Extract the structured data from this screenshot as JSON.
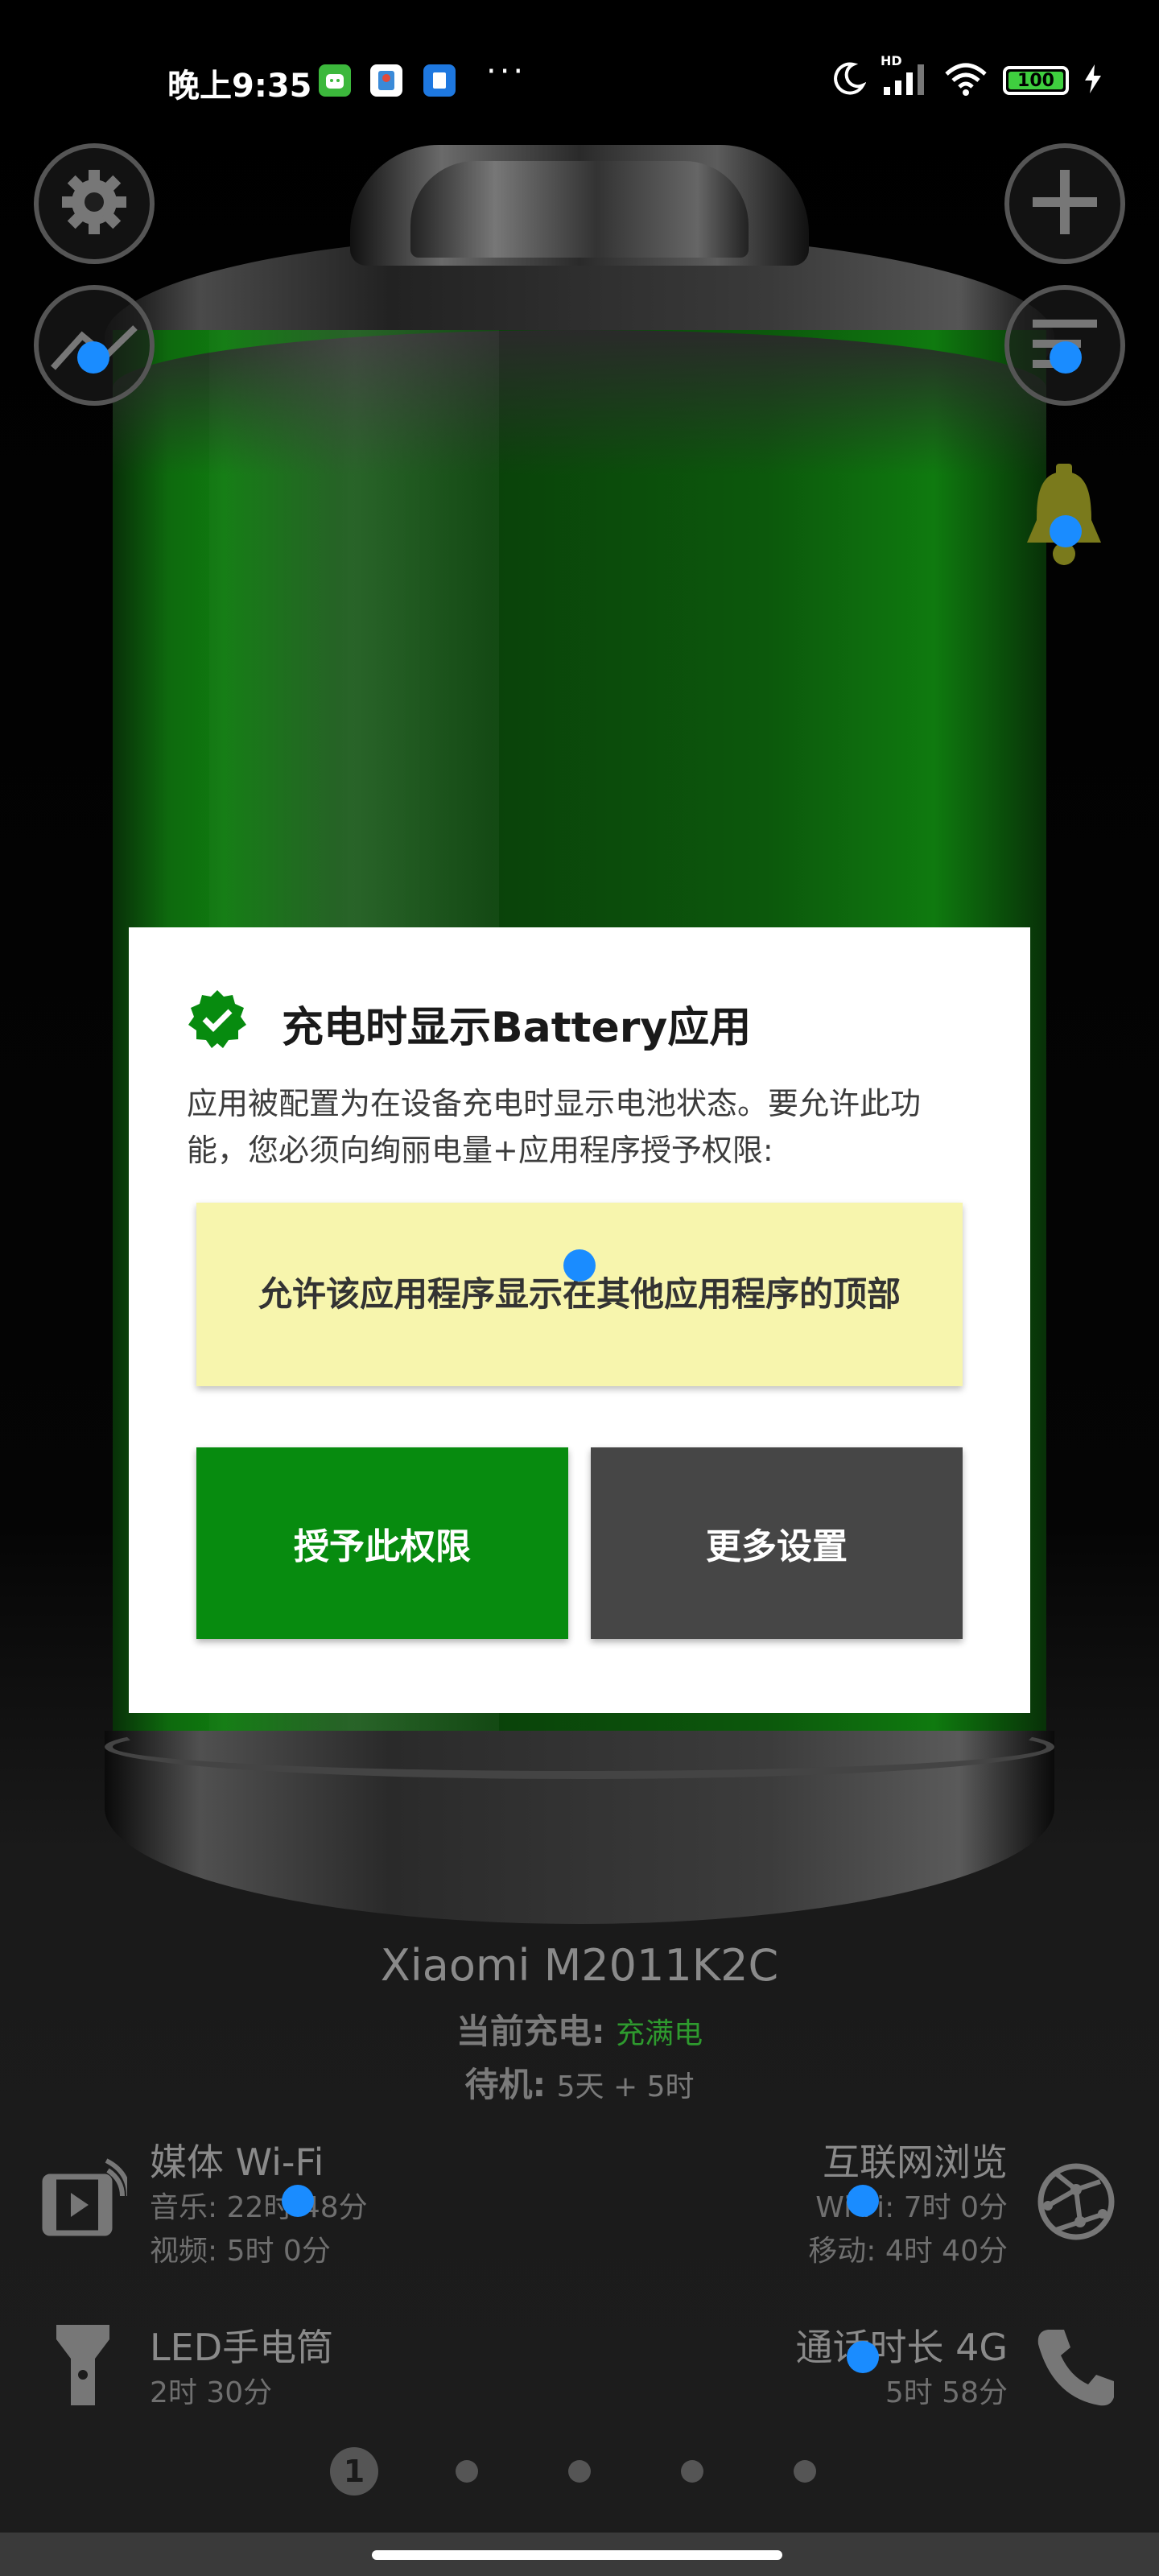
{
  "status_bar": {
    "time": "晚上9:35",
    "signal_label": "HD",
    "battery_level": "100",
    "icons": [
      "android-app-icon",
      "app-icon-2",
      "app-icon-3",
      "more-dots-icon",
      "moon-icon",
      "signal-icon",
      "wifi-icon",
      "battery-icon",
      "charging-bolt-icon"
    ],
    "more_dots": "···"
  },
  "top_controls": {
    "left": [
      "gear-icon",
      "chart-icon"
    ],
    "right": [
      "plus-icon",
      "filter-icon",
      "bell-icon"
    ]
  },
  "dialog": {
    "title": "充电时显示Battery应用",
    "body": "应用被配置为在设备充电时显示电池状态。要允许此功能，您必须向绚丽电量+应用程序授予权限:",
    "permission_text": "允许该应用程序显示在其他应用程序的顶部",
    "grant_button": "授予此权限",
    "more_settings_button": "更多设置",
    "accent_color": "#078b0f"
  },
  "device": {
    "name": "Xiaomi M2011K2C",
    "charging_label": "当前充电:",
    "charging_value": "充满电",
    "standby_label": "待机:",
    "standby_value": "5天 + 5时"
  },
  "stats": {
    "media_wifi": {
      "title": "媒体 Wi-Fi",
      "line1": "音乐: 22时 48分",
      "line2": "视频: 5时 0分"
    },
    "internet": {
      "title": "互联网浏览",
      "line1": "Wi-Fi: 7时 0分",
      "line2": "移动: 4时 40分"
    },
    "flashlight": {
      "title": "LED手电筒",
      "line1": "2时 30分"
    },
    "call": {
      "title": "通话时长 4G",
      "line1": "5时 58分"
    }
  },
  "pager": {
    "current_page": "1",
    "total_pages": 5
  }
}
